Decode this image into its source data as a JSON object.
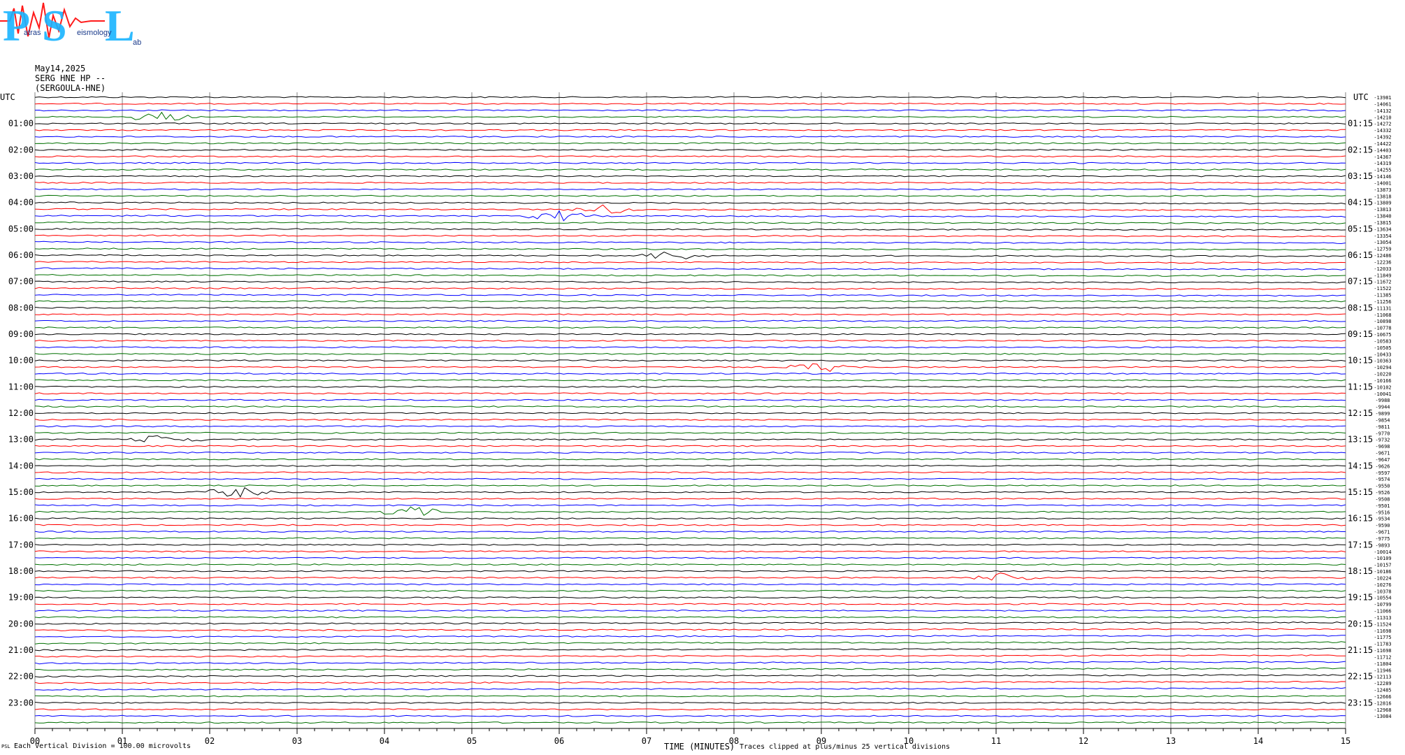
{
  "logo": {
    "letters": [
      "P",
      "S",
      "L"
    ],
    "subtitle_text": [
      "atras",
      "eismology",
      "ab"
    ]
  },
  "header": {
    "date": "May14,2025",
    "station": "SERG HNE HP --",
    "location": "(SERGOULA-HNE)"
  },
  "colors": {
    "trace_cycle": [
      "#000000",
      "#ff0000",
      "#0000ff",
      "#007000"
    ],
    "logo_blue": "#19b4ff",
    "logo_red": "#ff1a1a",
    "grid": "#808080"
  },
  "chart_data": {
    "type": "line",
    "title": "",
    "xlabel": "TIME (MINUTES)",
    "ylabel": "",
    "xlim": [
      0,
      15
    ],
    "x_ticks": [
      "00",
      "01",
      "02",
      "03",
      "04",
      "05",
      "06",
      "07",
      "08",
      "09",
      "10",
      "11",
      "12",
      "13",
      "14",
      "15"
    ],
    "left_axis_label": "UTC",
    "right_axis_label": "UTC",
    "left_time_labels": [
      "01:00",
      "02:00",
      "03:00",
      "04:00",
      "05:00",
      "06:00",
      "07:00",
      "08:00",
      "09:00",
      "10:00",
      "11:00",
      "12:00",
      "13:00",
      "14:00",
      "15:00",
      "16:00",
      "17:00",
      "18:00",
      "19:00",
      "20:00",
      "21:00",
      "22:00",
      "23:00"
    ],
    "right_time_labels": [
      "01:15",
      "02:15",
      "03:15",
      "04:15",
      "05:15",
      "06:15",
      "07:15",
      "08:15",
      "09:15",
      "10:15",
      "11:15",
      "12:15",
      "13:15",
      "14:15",
      "15:15",
      "16:15",
      "17:15",
      "18:15",
      "19:15",
      "20:15",
      "21:15",
      "22:15",
      "23:15"
    ],
    "trace_count": 96,
    "trace_color_cycle": [
      "black",
      "red",
      "blue",
      "green"
    ],
    "right_offset_values": [
      "-13981",
      "-14061",
      "-14132",
      "-14210",
      "-14272",
      "-14332",
      "-14392",
      "-14422",
      "-14403",
      "-14367",
      "-14319",
      "-14255",
      "-14146",
      "-14001",
      "-13873",
      "-13818",
      "-13809",
      "-13813",
      "-13840",
      "-13815",
      "-13634",
      "-13354",
      "-13054",
      "-12759",
      "-12486",
      "-12236",
      "-12033",
      "-11849",
      "-11672",
      "-11522",
      "-11385",
      "-11256",
      "-11131",
      "-11068",
      "-10898",
      "-10778",
      "-10675",
      "-10583",
      "-10505",
      "-10433",
      "-10363",
      "-10294",
      "-10220",
      "-10166",
      "-10102",
      "-10041",
      "-9988",
      "-9944",
      "-9899",
      "-9854",
      "-9811",
      "-9770",
      "-9732",
      "-9698",
      "-9671",
      "-9647",
      "-9626",
      "-9597",
      "-9574",
      "-9550",
      "-9526",
      "-9508",
      "-9501",
      "-9516",
      "-9534",
      "-9590",
      "-9671",
      "-9775",
      "-9893",
      "-10014",
      "-10109",
      "-10157",
      "-10186",
      "-10224",
      "-10276",
      "-10378",
      "-10554",
      "-10799",
      "-11066",
      "-11313",
      "-11524",
      "-11698",
      "-11775",
      "-11783",
      "-11698",
      "-11712",
      "-11804",
      "-11946",
      "-12113",
      "-12289",
      "-12485",
      "-12666",
      "-12816",
      "-12968",
      "-13084",
      ""
    ],
    "events": [
      {
        "trace": 3,
        "minute": 1.4,
        "label": ""
      },
      {
        "trace": 17,
        "minute": 6.5,
        "label": ""
      },
      {
        "trace": 18,
        "minute": 6.0,
        "label": ""
      },
      {
        "trace": 24,
        "minute": 7.3,
        "label": ""
      },
      {
        "trace": 41,
        "minute": 9.0,
        "label": ""
      },
      {
        "trace": 52,
        "minute": 1.5,
        "label": ""
      },
      {
        "trace": 60,
        "minute": 2.3,
        "label": ""
      },
      {
        "trace": 63,
        "minute": 4.3,
        "label": ""
      },
      {
        "trace": 73,
        "minute": 11.1,
        "label": ""
      }
    ]
  },
  "footer": {
    "scale_note": "Each Vertical Division =  100.00 microvolts",
    "time_label": "TIME (MINUTES)",
    "clip_note": "Traces clipped at plus/minus 25 vertical divisions",
    "small_mark": "PSL"
  }
}
